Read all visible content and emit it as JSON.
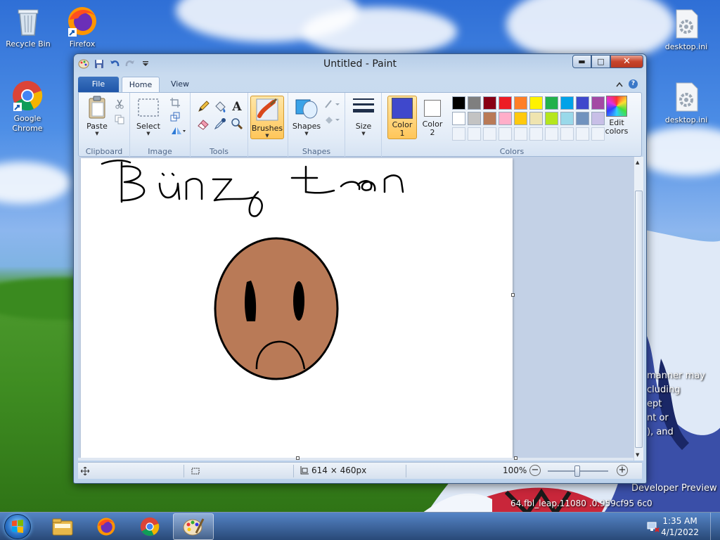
{
  "desktop": {
    "icons": [
      {
        "label": "Recycle Bin"
      },
      {
        "label": "Firefox"
      },
      {
        "label": "Google Chrome"
      },
      {
        "label": "desktop.ini"
      },
      {
        "label": "desktop.ini"
      }
    ],
    "watermark_lines": [
      "manner may",
      "cluding",
      "ept",
      "nt or",
      "), and"
    ],
    "build_text": "Developer Preview",
    "build_string": "64.fbl_leap.11080 .0.959cf95 6c0"
  },
  "window": {
    "title": "Untitled - Paint",
    "tabs": {
      "file": "File",
      "home": "Home",
      "view": "View"
    },
    "groups": {
      "clipboard": "Clipboard",
      "image": "Image",
      "tools": "Tools",
      "shapes": "Shapes",
      "colors": "Colors"
    },
    "buttons": {
      "paste": "Paste",
      "select": "Select",
      "brushes": "Brushes",
      "shapes": "Shapes",
      "size": "Size",
      "color1_line1": "Color",
      "color1_line2": "1",
      "color2_line1": "Color",
      "color2_line2": "2",
      "edit_colors_line1": "Edit",
      "edit_colors_line2": "colors"
    },
    "colors": {
      "color1": "#3f48cc",
      "color2": "#ffffff",
      "palette_row1": [
        "#000000",
        "#7f7f7f",
        "#880015",
        "#ed1c24",
        "#ff7f27",
        "#fff200",
        "#22b14c",
        "#00a2e8",
        "#3f48cc",
        "#a349a4"
      ],
      "palette_row2": [
        "#ffffff",
        "#c3c3c3",
        "#b97a57",
        "#ffaec9",
        "#ffc90e",
        "#efe4b0",
        "#b5e61d",
        "#99d9ea",
        "#7092be",
        "#c8bfe7"
      ]
    },
    "drawing": {
      "text": "Bünz Loan",
      "face_color": "#b97a57"
    },
    "status": {
      "size": "614 × 460px",
      "zoom": "100%"
    }
  },
  "taskbar": {
    "time": "1:35 AM",
    "date": "4/1/2022"
  }
}
